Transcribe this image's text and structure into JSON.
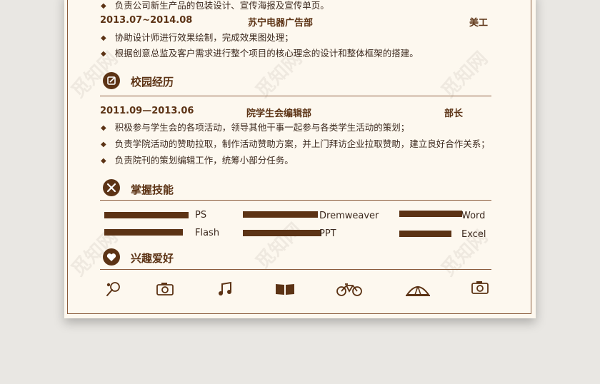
{
  "experience": {
    "top_bullet": "负责公司新生产品的包装设计、宣传海报及宣传单页。",
    "job": {
      "date": "2013.07~2014.08",
      "org": "苏宁电器广告部",
      "role": "美工",
      "bullets": [
        "协助设计师进行效果绘制，完成效果图处理；",
        "根据创意总监及客户需求进行整个项目的核心理念的设计和整体框架的搭建。"
      ]
    }
  },
  "campus": {
    "title": "校园经历",
    "icon": "edit-icon",
    "entry": {
      "date": "2011.09—2013.06",
      "org": "院学生会编辑部",
      "role": "部长",
      "bullets": [
        "积极参与学生会的各项活动，领导其他干事一起参与各类学生活动的策划；",
        "负责学院活动的赞助拉取，制作活动赞助方案，并上门拜访企业拉取赞助，建立良好合作关系；",
        "负责院刊的策划编辑工作，统筹小部分任务。"
      ]
    }
  },
  "skills": {
    "title": "掌握技能",
    "icon": "tools-icon",
    "items": [
      {
        "name": "PS",
        "level": 0.85
      },
      {
        "name": "Dremweaver",
        "level": 0.7
      },
      {
        "name": "Word",
        "level": 0.72
      },
      {
        "name": "Flash",
        "level": 0.68
      },
      {
        "name": "PPT",
        "level": 0.73
      },
      {
        "name": "Excel",
        "level": 0.6
      }
    ]
  },
  "hobbies": {
    "title": "兴趣爱好",
    "icon": "heart-icon",
    "items": [
      "badminton-icon",
      "camera-icon",
      "music-icon",
      "book-icon",
      "bicycle-icon",
      "tent-icon",
      "camera-icon"
    ]
  },
  "watermark": "觅知网",
  "colors": {
    "accent": "#5c3315",
    "paper": "#fdf8ef",
    "background": "#e9e7e3"
  }
}
